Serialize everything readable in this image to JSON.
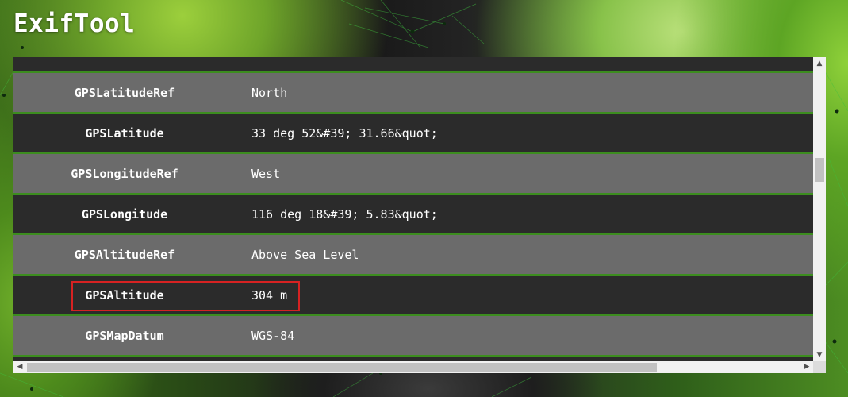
{
  "app": {
    "title": "ExifTool"
  },
  "table": {
    "rows": [
      {
        "key": "GPSLatitudeRef",
        "value": "North"
      },
      {
        "key": "GPSLatitude",
        "value": "33 deg 52&#39; 31.66&quot;"
      },
      {
        "key": "GPSLongitudeRef",
        "value": "West"
      },
      {
        "key": "GPSLongitude",
        "value": "116 deg 18&#39; 5.83&quot;"
      },
      {
        "key": "GPSAltitudeRef",
        "value": "Above Sea Level"
      },
      {
        "key": "GPSAltitude",
        "value": "304 m"
      },
      {
        "key": "GPSMapDatum",
        "value": "WGS-84"
      }
    ],
    "highlighted_row": "GPSAltitude"
  },
  "icons": {
    "scroll_up": "chevron-up-icon",
    "scroll_down": "chevron-down-icon",
    "scroll_left": "chevron-left-icon",
    "scroll_right": "chevron-right-icon"
  },
  "colors": {
    "row_light": "#6b6b6b",
    "row_dark": "#2b2b2b",
    "row_border": "#3c8d1f",
    "highlight": "#d62222",
    "text": "#ffffff"
  }
}
